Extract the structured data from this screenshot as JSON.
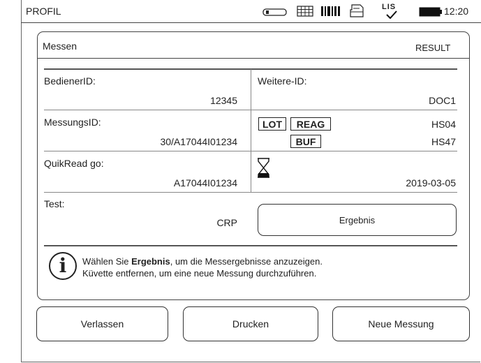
{
  "status_bar": {
    "title": "PROFIL",
    "lis_label": "LIS",
    "time": "12:20",
    "icons": [
      "cuvette-icon",
      "keypad-icon",
      "barcode-icon",
      "printer-icon",
      "lis-check-icon",
      "battery-icon"
    ]
  },
  "panel": {
    "title": "Messen",
    "mode": "RESULT",
    "operator": {
      "label": "BedienerID:",
      "value": "12345"
    },
    "other_id": {
      "label": "Weitere-ID:",
      "value": "DOC1"
    },
    "measurement": {
      "label": "MessungsID:",
      "value": "30/A17044I01234"
    },
    "lot": {
      "lot_label": "LOT",
      "reag_label": "REAG",
      "reag_value": "HS04",
      "buf_label": "BUF",
      "buf_value": "HS47"
    },
    "instrument": {
      "label": "QuikRead go:",
      "value": "A17044I01234"
    },
    "expiry": {
      "icon": "hourglass-icon",
      "value": "2019-03-05"
    },
    "test": {
      "label": "Test:",
      "value": "CRP"
    },
    "result_button": "Ergebnis",
    "info": {
      "line1_pre": "Wählen Sie ",
      "line1_bold": "Ergebnis",
      "line1_post": ", um die Messergebnisse anzuzeigen.",
      "line2": "Küvette entfernen, um eine neue Messung durchzuführen."
    }
  },
  "buttons": {
    "exit": "Verlassen",
    "print": "Drucken",
    "new": "Neue Messung"
  }
}
